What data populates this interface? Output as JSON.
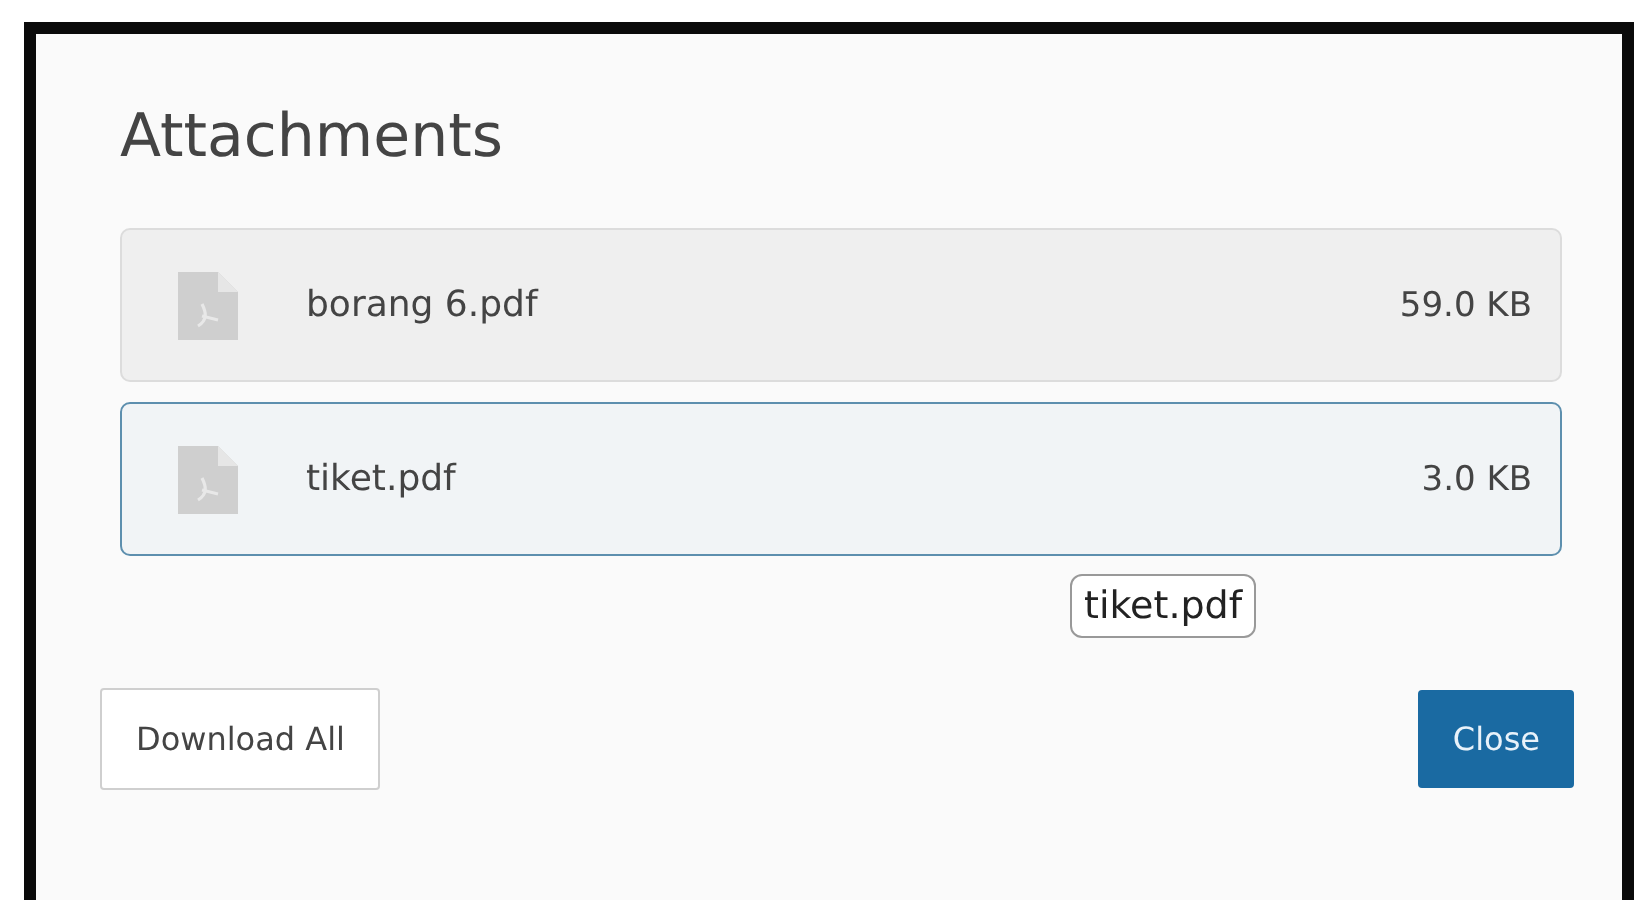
{
  "dialog": {
    "title": "Attachments"
  },
  "attachments": [
    {
      "name": "borang 6.pdf",
      "size": "59.0 KB",
      "selected": false
    },
    {
      "name": "tiket.pdf",
      "size": "3.0 KB",
      "selected": true
    }
  ],
  "tooltip": {
    "text": "tiket.pdf"
  },
  "buttons": [
    {
      "label": "Download All",
      "kind": "secondary"
    },
    {
      "label": "Close",
      "kind": "primary"
    }
  ]
}
